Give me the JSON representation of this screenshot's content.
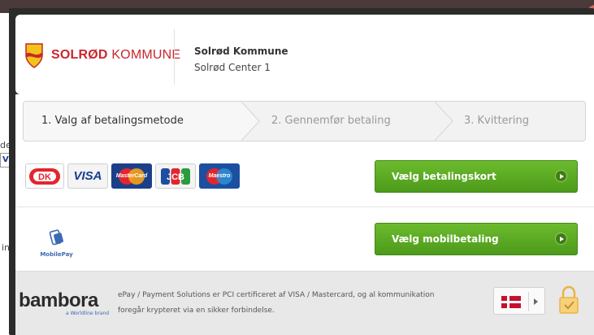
{
  "merchant": {
    "logo_main": "SOLRØD",
    "logo_rest": "KOMMUNE",
    "name": "Solrød Kommune",
    "address": "Solrød Center 1"
  },
  "steps": [
    {
      "label": "1. Valg af betalingsmetode",
      "active": true
    },
    {
      "label": "2. Gennemfør betaling",
      "active": false
    },
    {
      "label": "3. Kvittering",
      "active": false
    }
  ],
  "payment_cards": {
    "brands": [
      {
        "name": "Dankort",
        "icon": "dankort-icon"
      },
      {
        "name": "VISA",
        "icon": "visa-icon"
      },
      {
        "name": "MasterCard",
        "icon": "mastercard-icon"
      },
      {
        "name": "JCB",
        "icon": "jcb-icon"
      },
      {
        "name": "Maestro",
        "icon": "maestro-icon"
      }
    ],
    "button_label": "Vælg betalingskort"
  },
  "mobilepay": {
    "label": "MobilePay",
    "button_label": "Vælg mobilbetaling"
  },
  "footer": {
    "brand": "bambora",
    "brand_sub": "a Worldline brand",
    "security_text_line1": "ePay / Payment Solutions er PCI certificeret af VISA / Mastercard, og al kommunikation",
    "security_text_line2": "foregår krypteret via en sikker forbindelse.",
    "language_icon": "danish-flag-icon",
    "lock_icon": "padlock-check-icon"
  },
  "backdrop": {
    "text1": "de",
    "box_text": "V",
    "text2": "in"
  },
  "colors": {
    "brand_red": "#c8272d",
    "button_green": "#5aa823",
    "modal_dark": "#2b2b2b",
    "lock_gold": "#e8b547"
  }
}
